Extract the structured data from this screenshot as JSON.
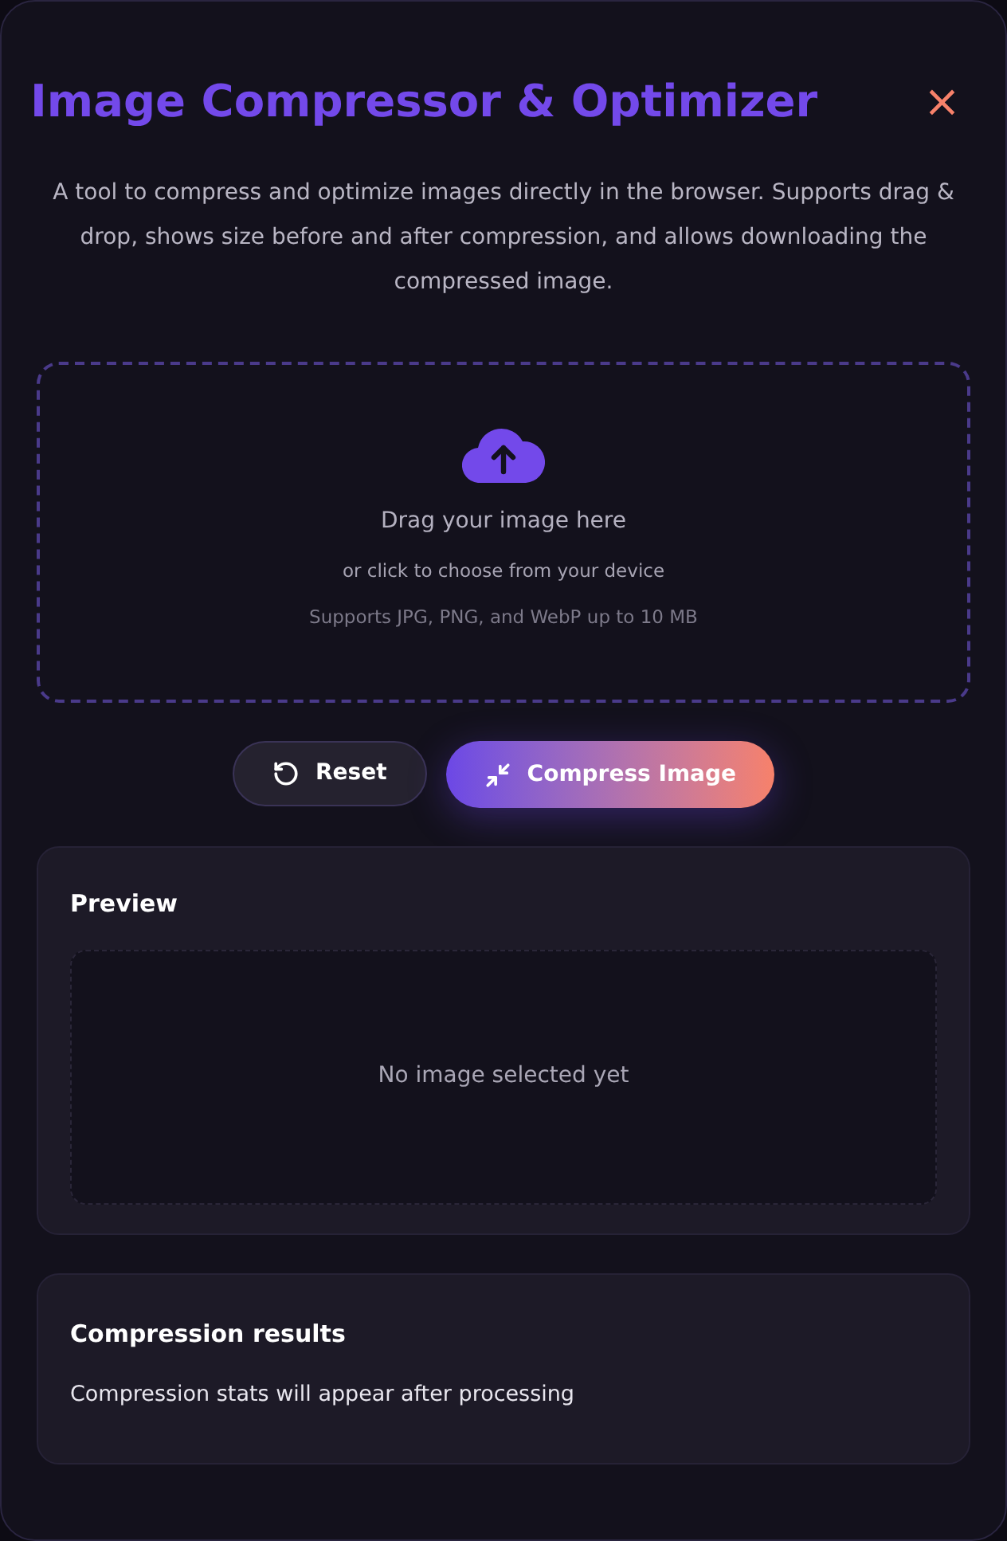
{
  "modal": {
    "title": "Image Compressor & Optimizer",
    "close": "×",
    "description": "A tool to compress and optimize images directly in the browser. Supports drag & drop, shows size before and after compression, and allows downloading the compressed image."
  },
  "dropzone": {
    "title": "Drag your image here",
    "subtitle": "or click to choose from your device",
    "hint": "Supports JPG, PNG, and WebP up to 10 MB"
  },
  "buttons": [
    {
      "kind": "secondary",
      "label": "Reset"
    },
    {
      "kind": "primary",
      "label": "Compress Image"
    }
  ],
  "preview": {
    "title": "Preview",
    "empty": "No image selected yet"
  },
  "results": {
    "title": "Compression results",
    "empty": "Compression stats will appear after processing"
  }
}
